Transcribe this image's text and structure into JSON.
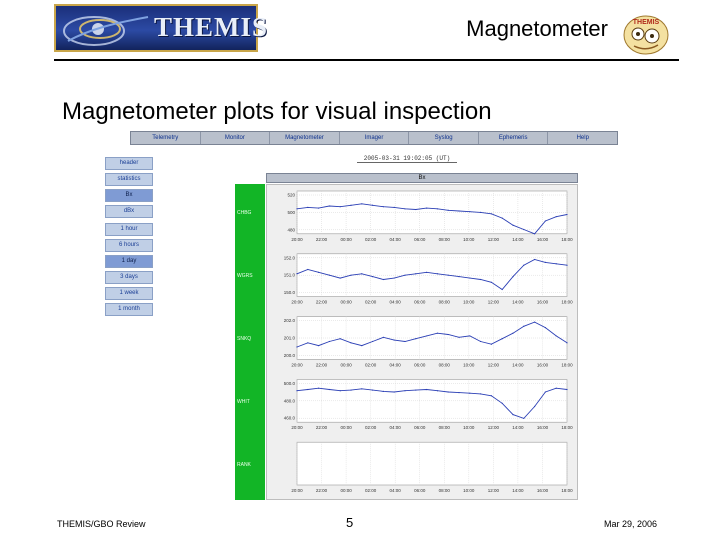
{
  "header": {
    "logo_text": "THEMIS",
    "title": "Magnetometer",
    "mascot_text": "THEMIS"
  },
  "heading": "Magnetometer plots for visual inspection",
  "nav": [
    "Telemetry",
    "Monitor",
    "Magnetometer",
    "Imager",
    "Syslog",
    "Ephemeris",
    "Help"
  ],
  "date_label": "2005-03-31 19:02:05 (UT)",
  "sidebar": {
    "items": [
      {
        "label": "header",
        "selected": false
      },
      {
        "label": "statistics",
        "selected": false
      },
      {
        "label": "Bx",
        "selected": true
      },
      {
        "label": "dBx",
        "selected": false
      },
      {
        "label": "1 hour",
        "selected": false
      },
      {
        "label": "6 hours",
        "selected": false
      },
      {
        "label": "1 day",
        "selected": true
      },
      {
        "label": "3 days",
        "selected": false
      },
      {
        "label": "1 week",
        "selected": false
      },
      {
        "label": "1 month",
        "selected": false
      }
    ]
  },
  "plot_header": "Bx",
  "chart_data": {
    "type": "line",
    "x_tick_labels": [
      "20:00",
      "22:00",
      "00:00",
      "02:00",
      "04:00",
      "06:00",
      "08:00",
      "10:00",
      "12:00",
      "14:00",
      "16:00",
      "18:00"
    ],
    "panels": [
      {
        "station": "CHBG",
        "yticks": [
          "520",
          "500",
          "480"
        ],
        "ylim": [
          470,
          530
        ],
        "values": [
          505,
          507,
          506,
          509,
          508,
          510,
          512,
          510,
          508,
          507,
          505,
          504,
          506,
          505,
          503,
          502,
          501,
          500,
          498,
          492,
          482,
          476,
          470,
          488,
          494,
          497
        ]
      },
      {
        "station": "WGRS",
        "yticks": [
          "152.0",
          "151.0",
          "150.0"
        ],
        "ylim": [
          149.4,
          152.4
        ],
        "values": [
          151.0,
          151.3,
          151.1,
          150.9,
          150.7,
          150.9,
          151.0,
          150.8,
          150.6,
          150.7,
          150.9,
          151.0,
          151.1,
          151.0,
          150.9,
          150.8,
          150.7,
          150.6,
          150.4,
          149.9,
          150.8,
          151.6,
          152.0,
          151.8,
          151.7,
          151.6
        ]
      },
      {
        "station": "SNKQ",
        "yticks": [
          "202.0",
          "201.0",
          "200.0"
        ],
        "ylim": [
          199.3,
          202.4
        ],
        "values": [
          200.2,
          200.5,
          200.3,
          200.6,
          200.8,
          200.5,
          200.3,
          200.6,
          200.9,
          200.7,
          200.6,
          200.8,
          201.0,
          201.2,
          201.1,
          200.9,
          201.0,
          200.6,
          200.4,
          200.8,
          201.2,
          201.7,
          202.0,
          201.6,
          201.0,
          200.5
        ]
      },
      {
        "station": "WHIT",
        "yticks": [
          "500.0",
          "480.0",
          "460.0"
        ],
        "ylim": [
          440,
          508
        ],
        "values": [
          490,
          492,
          494,
          492,
          490,
          491,
          493,
          491,
          489,
          488,
          490,
          491,
          492,
          490,
          488,
          487,
          486,
          485,
          482,
          470,
          452,
          446,
          465,
          488,
          494,
          492
        ]
      },
      {
        "station": "RANK",
        "yticks": [],
        "ylim": [
          0,
          1
        ],
        "values": []
      }
    ]
  },
  "footer": {
    "left": "THEMIS/GBO Review",
    "page": "5",
    "right": "Mar 29, 2006"
  }
}
